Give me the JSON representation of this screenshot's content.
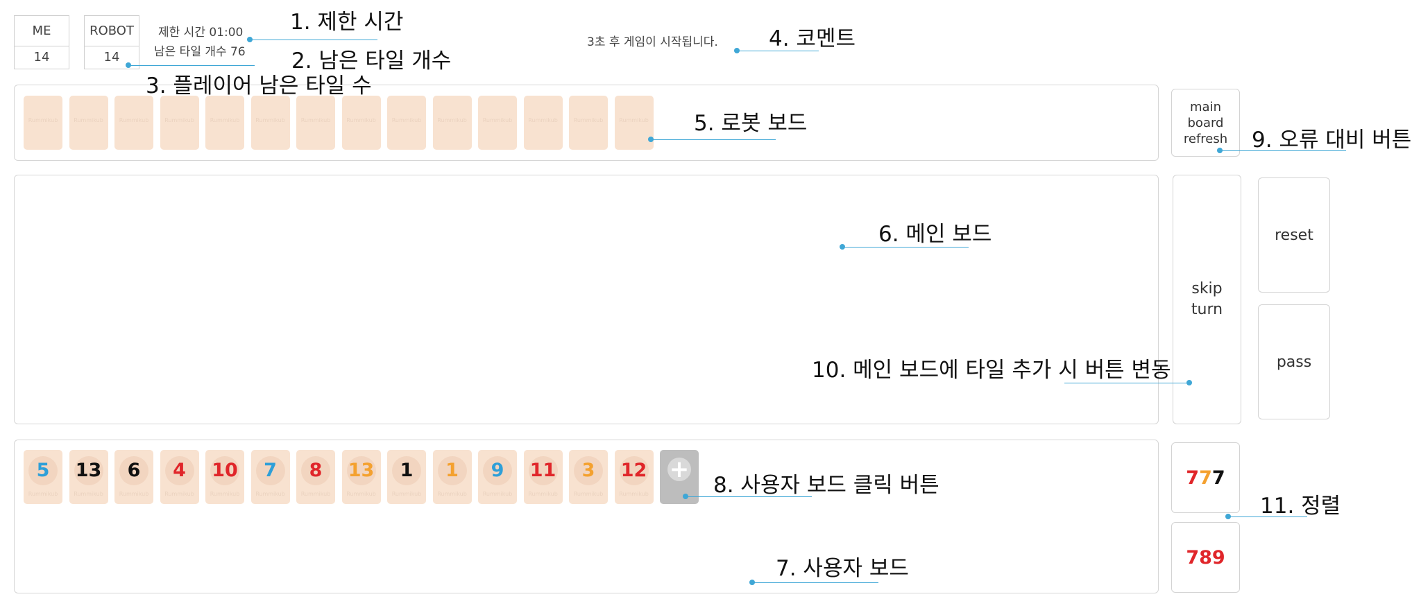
{
  "scores": {
    "me": {
      "label": "ME",
      "value": "14"
    },
    "robot": {
      "label": "ROBOT",
      "value": "14"
    }
  },
  "status": {
    "time_limit": "제한 시간 01:00",
    "remaining_tiles": "남은 타일 개수 76",
    "comment": "3초 후 게임이 시작됩니다."
  },
  "watermark": "Rummikub",
  "robot_board": {
    "tile_count": 14
  },
  "user_tiles": [
    {
      "value": "5",
      "color": "#2e9fd8"
    },
    {
      "value": "13",
      "color": "#111111"
    },
    {
      "value": "6",
      "color": "#111111"
    },
    {
      "value": "4",
      "color": "#e0262a"
    },
    {
      "value": "10",
      "color": "#e0262a"
    },
    {
      "value": "7",
      "color": "#2e9fd8"
    },
    {
      "value": "8",
      "color": "#e0262a"
    },
    {
      "value": "13",
      "color": "#f4a12f"
    },
    {
      "value": "1",
      "color": "#111111"
    },
    {
      "value": "1",
      "color": "#f4a12f"
    },
    {
      "value": "9",
      "color": "#2e9fd8"
    },
    {
      "value": "11",
      "color": "#e0262a"
    },
    {
      "value": "3",
      "color": "#f4a12f"
    },
    {
      "value": "12",
      "color": "#e0262a"
    }
  ],
  "buttons": {
    "refresh": "main board refresh",
    "skip_turn": "skip turn",
    "reset": "reset",
    "pass": "pass",
    "add_icon": "plus-icon"
  },
  "sort_buttons": {
    "by_number": [
      {
        "digit": "7",
        "color": "#e0262a"
      },
      {
        "digit": "7",
        "color": "#f4a12f"
      },
      {
        "digit": "7",
        "color": "#111111"
      }
    ],
    "by_run": {
      "text": "789",
      "color": "#e0262a"
    }
  },
  "annotations": {
    "a1": "1. 제한 시간",
    "a2": "2. 남은 타일 개수",
    "a3": "3. 플레이어 남은 타일 수",
    "a4": "4. 코멘트",
    "a5": "5. 로봇 보드",
    "a6": "6. 메인 보드",
    "a7": "7. 사용자 보드",
    "a8": "8. 사용자 보드 클릭 버튼",
    "a9": "9. 오류 대비 버튼",
    "a10": "10. 메인 보드에 타일 추가 시 버튼 변동",
    "a11": "11. 정렬"
  }
}
